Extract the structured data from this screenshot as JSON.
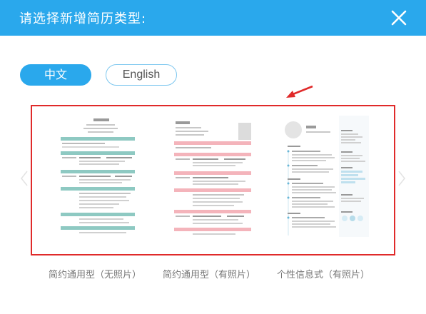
{
  "header": {
    "title": "请选择新增简历类型:"
  },
  "tabs": [
    {
      "label": "中文",
      "active": true
    },
    {
      "label": "English",
      "active": false
    }
  ],
  "templates": [
    {
      "caption": "简约通用型（无照片）"
    },
    {
      "caption": "简约通用型（有照片）"
    },
    {
      "caption": "个性信息式（有照片）"
    }
  ],
  "colors": {
    "accent": "#2aa8ec",
    "highlight": "#e02a2a",
    "teal": "#8ec9c2",
    "pink": "#f0a8b0"
  }
}
